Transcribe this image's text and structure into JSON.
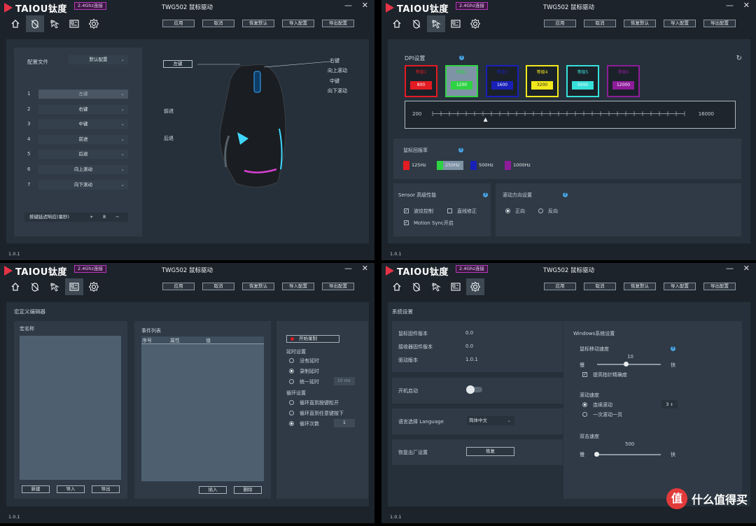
{
  "common": {
    "brand": "TAIOU钛度",
    "badge": "2.4Ghz连接",
    "title": "TWG502 鼠标驱动",
    "minimize": "—",
    "close": "✕",
    "version": "1.0.1",
    "actions": [
      "应用",
      "取消",
      "恢复默认",
      "导入配置",
      "导出配置"
    ],
    "icons": [
      "home-icon",
      "mouse-icon",
      "cursor-icon",
      "macro-icon",
      "settings-icon"
    ]
  },
  "colors": {
    "accent_red": "#e63346",
    "panel": "#2f3a46",
    "dpi": [
      "#e31b23",
      "#2ed341",
      "#1820b8",
      "#f3e81c",
      "#36e0d9",
      "#8e1c9a"
    ],
    "rates": [
      "#e31b23",
      "#2ed341",
      "#1820b8",
      "#8e1c9a"
    ]
  },
  "keys": {
    "profile_label": "配置文件",
    "profile_value": "默认配置",
    "rows": [
      {
        "num": "1",
        "value": "左键"
      },
      {
        "num": "2",
        "value": "右键"
      },
      {
        "num": "3",
        "value": "中键"
      },
      {
        "num": "4",
        "value": "前进"
      },
      {
        "num": "5",
        "value": "后退"
      },
      {
        "num": "6",
        "value": "向上滚动"
      },
      {
        "num": "7",
        "value": "向下滚动"
      }
    ],
    "delay_label": "按键延迟响应(毫秒)",
    "delay_plus": "+",
    "delay_value": "8",
    "delay_minus": "−",
    "callouts_left": [
      "左键",
      "前进",
      "后退"
    ],
    "callouts_right": [
      "右键",
      "向上滚动",
      "中键",
      "向下滚动"
    ]
  },
  "dpi": {
    "title": "DPI设置",
    "levels": [
      {
        "name": "等级1",
        "value": "800"
      },
      {
        "name": "等级2",
        "value": "1200"
      },
      {
        "name": "等级3",
        "value": "1600"
      },
      {
        "name": "等级4",
        "value": "3200"
      },
      {
        "name": "等级5",
        "value": "5000"
      },
      {
        "name": "等级6",
        "value": "12000"
      }
    ],
    "slider_min": "200",
    "slider_max": "16000",
    "slider_fraction": 0.21,
    "rate_title": "鼠标回报率",
    "rates": [
      "125Hz",
      "250Hz",
      "500Hz",
      "1000Hz"
    ],
    "selected_rate": 1,
    "sensor_title": "Sensor 高级性能",
    "sensor_opts": [
      "波纹控制",
      "直线修正",
      "Motion Sync开启"
    ],
    "scroll_title": "滚动方向设置",
    "scroll_opts": [
      "正向",
      "反向"
    ]
  },
  "macro": {
    "title": "宏定义编辑器",
    "name_label": "宏名称",
    "btn_new": "新建",
    "btn_import": "导入",
    "btn_export": "导出",
    "events_label": "事件列表",
    "cols": [
      "序号",
      "属性",
      "值"
    ],
    "btn_insert": "插入",
    "btn_delete": "删除",
    "record": "开始录制",
    "delay_title": "延时设置",
    "delay_opts": [
      "没有延时",
      "录制延时",
      "统一延时"
    ],
    "delay_value": "10",
    "delay_unit": "ms",
    "loop_title": "循环设置",
    "loop_opts": [
      "循环直到按键松开",
      "循环直到任意键按下",
      "循环次数"
    ],
    "loop_value": "1"
  },
  "system": {
    "title": "系统设置",
    "info": [
      {
        "label": "鼠标固件版本",
        "value": "0.0"
      },
      {
        "label": "接收器固件版本",
        "value": "0.0"
      },
      {
        "label": "驱动版本",
        "value": "1.0.1"
      }
    ],
    "startup_label": "开机启动",
    "lang_label": "语言选择 Language",
    "lang_value": "简体中文",
    "reset_label": "恢复出厂设置",
    "reset_btn": "恢复",
    "win_title": "Windows系统设置",
    "speed_title": "鼠标移动速度",
    "speed_value": "10",
    "speed_fraction": 0.45,
    "slow": "慢",
    "fast": "快",
    "precision": "提高指针精确度",
    "scroll_title": "滚动速度",
    "scroll_opts": [
      "连续滚动",
      "一次滚动一页"
    ],
    "scroll_value": "3",
    "dbl_title": "双击速度",
    "dbl_value": "500",
    "dbl_fraction": 0.0,
    "watermark": "值 什么值得买"
  },
  "chart_data": {
    "type": "table",
    "title": "DPI设置",
    "categories": [
      "等级1",
      "等级2",
      "等级3",
      "等级4",
      "等级5",
      "等级6"
    ],
    "values": [
      800,
      1200,
      1600,
      3200,
      5000,
      12000
    ],
    "ylim": [
      200,
      16000
    ],
    "report_rates_hz": [
      125,
      250,
      500,
      1000
    ]
  }
}
